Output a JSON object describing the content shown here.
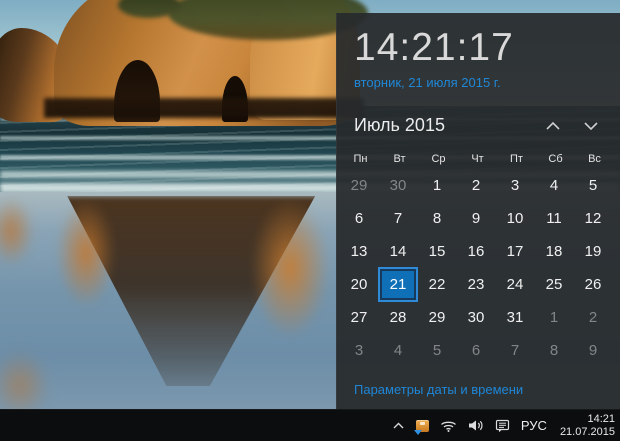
{
  "clock_flyout": {
    "time": "14:21:17",
    "date_full": "вторник, 21 июля 2015 г.",
    "settings_link": "Параметры даты и времени",
    "calendar": {
      "month_label": "Июль 2015",
      "day_headers": [
        "Пн",
        "Вт",
        "Ср",
        "Чт",
        "Пт",
        "Сб",
        "Вс"
      ],
      "selected_day": "21",
      "weeks": [
        [
          {
            "d": "29",
            "out": true
          },
          {
            "d": "30",
            "out": true
          },
          {
            "d": "1"
          },
          {
            "d": "2"
          },
          {
            "d": "3"
          },
          {
            "d": "4"
          },
          {
            "d": "5"
          }
        ],
        [
          {
            "d": "6"
          },
          {
            "d": "7"
          },
          {
            "d": "8"
          },
          {
            "d": "9"
          },
          {
            "d": "10"
          },
          {
            "d": "11"
          },
          {
            "d": "12"
          }
        ],
        [
          {
            "d": "13"
          },
          {
            "d": "14"
          },
          {
            "d": "15"
          },
          {
            "d": "16"
          },
          {
            "d": "17"
          },
          {
            "d": "18"
          },
          {
            "d": "19"
          }
        ],
        [
          {
            "d": "20"
          },
          {
            "d": "21",
            "sel": true
          },
          {
            "d": "22"
          },
          {
            "d": "23"
          },
          {
            "d": "24"
          },
          {
            "d": "25"
          },
          {
            "d": "26"
          }
        ],
        [
          {
            "d": "27"
          },
          {
            "d": "28"
          },
          {
            "d": "29"
          },
          {
            "d": "30"
          },
          {
            "d": "31"
          },
          {
            "d": "1",
            "out": true
          },
          {
            "d": "2",
            "out": true
          }
        ],
        [
          {
            "d": "3",
            "out": true
          },
          {
            "d": "4",
            "out": true
          },
          {
            "d": "5",
            "out": true
          },
          {
            "d": "6",
            "out": true
          },
          {
            "d": "7",
            "out": true
          },
          {
            "d": "8",
            "out": true
          },
          {
            "d": "9",
            "out": true
          }
        ]
      ]
    }
  },
  "taskbar": {
    "tray": {
      "icons": [
        "hidden-icons-chevron",
        "update-icon",
        "wifi-icon",
        "volume-icon",
        "action-center-icon"
      ],
      "language": "РУС",
      "time": "14:21",
      "date": "21.07.2015"
    }
  },
  "colors": {
    "accent_blue": "#1f87d7",
    "selected_day_fill": "#0f70b8",
    "selected_day_ring": "#2f8bd8",
    "flyout_background": "#272b2d",
    "taskbar_background": "#0b0d0f"
  }
}
